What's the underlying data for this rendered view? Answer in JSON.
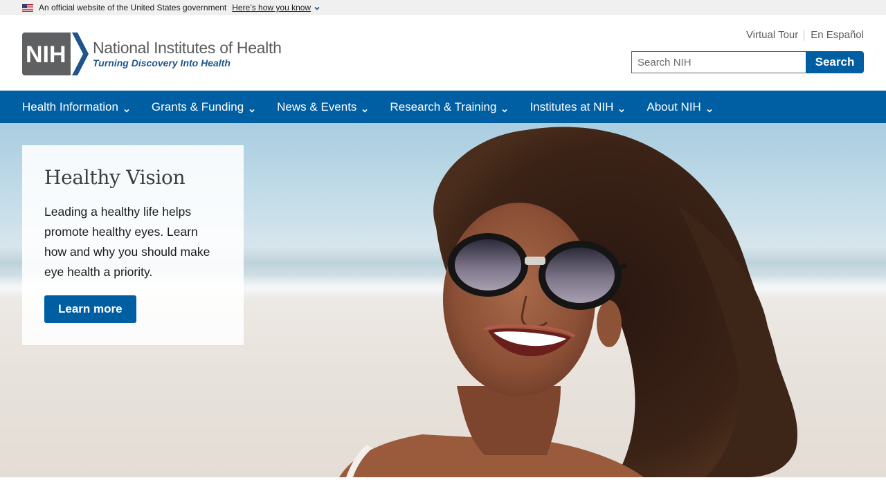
{
  "gov_banner": {
    "text": "An official website of the United States government",
    "link": "Here’s how you know"
  },
  "logo": {
    "mark": "NIH",
    "title": "National Institutes of Health",
    "tagline": "Turning Discovery Into Health"
  },
  "util_links": [
    "Virtual Tour",
    "En Español"
  ],
  "search": {
    "placeholder": "Search NIH",
    "button": "Search"
  },
  "nav": {
    "items": [
      "Health Information",
      "Grants & Funding",
      "News & Events",
      "Research & Training",
      "Institutes at NIH",
      "About NIH"
    ]
  },
  "promo": {
    "title": "Healthy Vision",
    "body": "Leading a healthy life helps promote healthy eyes. Learn how and why you should make eye health a priority.",
    "button": "Learn more"
  },
  "colors": {
    "primary": "#005ea2",
    "logo_gray": "#5a5a5a",
    "logo_blue": "#20558a"
  }
}
